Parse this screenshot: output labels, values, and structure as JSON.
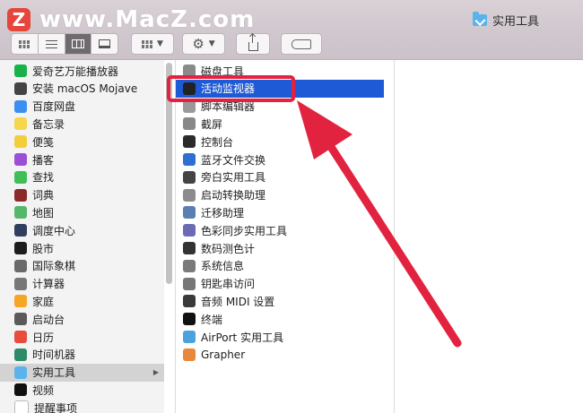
{
  "watermark": {
    "logo": "Z",
    "text": "www.MacZ.com"
  },
  "window": {
    "title": "实用工具",
    "title_icon": "folder-utilities-icon"
  },
  "toolbar": {
    "view_modes": [
      "icon-view",
      "list-view",
      "column-view",
      "gallery-view"
    ],
    "active_view": "column-view",
    "group_icon": "group-grid-icon",
    "action_icon": "gear-icon",
    "share_icon": "share-icon",
    "tag_icon": "tag-icon"
  },
  "sidebar_column": {
    "items": [
      {
        "label": "爱奇艺万能播放器",
        "icon": "iqiyi-player-icon",
        "color": "#19b24a"
      },
      {
        "label": "安装 macOS Mojave",
        "icon": "macos-mojave-installer-icon",
        "color": "#444444"
      },
      {
        "label": "百度网盘",
        "icon": "baidu-netdisk-icon",
        "color": "#3b8ff3"
      },
      {
        "label": "备忘录",
        "icon": "notes-icon",
        "color": "#f6d64b"
      },
      {
        "label": "便笺",
        "icon": "stickies-icon",
        "color": "#f2cf3a"
      },
      {
        "label": "播客",
        "icon": "podcasts-icon",
        "color": "#9b4fd7"
      },
      {
        "label": "查找",
        "icon": "find-my-icon",
        "color": "#3fbf57"
      },
      {
        "label": "词典",
        "icon": "dictionary-icon",
        "color": "#8b2a2a"
      },
      {
        "label": "地图",
        "icon": "maps-icon",
        "color": "#55b768"
      },
      {
        "label": "调度中心",
        "icon": "mission-control-icon",
        "color": "#2f3f5f"
      },
      {
        "label": "股市",
        "icon": "stocks-icon",
        "color": "#1c1c1c"
      },
      {
        "label": "国际象棋",
        "icon": "chess-icon",
        "color": "#6a6a6a"
      },
      {
        "label": "计算器",
        "icon": "calculator-icon",
        "color": "#777777"
      },
      {
        "label": "家庭",
        "icon": "home-icon",
        "color": "#f5a623"
      },
      {
        "label": "启动台",
        "icon": "launchpad-icon",
        "color": "#5a5a5a"
      },
      {
        "label": "日历",
        "icon": "calendar-icon",
        "color": "#e74c3c"
      },
      {
        "label": "时间机器",
        "icon": "time-machine-icon",
        "color": "#2f8a6a"
      },
      {
        "label": "实用工具",
        "icon": "utilities-folder-icon",
        "color": "#5bb3ec",
        "selected": true,
        "has_submenu": true
      },
      {
        "label": "视频",
        "icon": "tv-icon",
        "color": "#111111"
      },
      {
        "label": "提醒事项",
        "icon": "reminders-icon",
        "color": "#ffffff"
      }
    ]
  },
  "utilities_column": {
    "items": [
      {
        "label": "磁盘工具",
        "icon": "disk-utility-icon",
        "color": "#8a8a8a"
      },
      {
        "label": "活动监视器",
        "icon": "activity-monitor-icon",
        "color": "#222222",
        "selected": true
      },
      {
        "label": "脚本编辑器",
        "icon": "script-editor-icon",
        "color": "#9a9a9a"
      },
      {
        "label": "截屏",
        "icon": "screenshot-icon",
        "color": "#888888"
      },
      {
        "label": "控制台",
        "icon": "console-icon",
        "color": "#2b2b2b"
      },
      {
        "label": "蓝牙文件交换",
        "icon": "bluetooth-file-exchange-icon",
        "color": "#2f6fd0"
      },
      {
        "label": "旁白实用工具",
        "icon": "voiceover-utility-icon",
        "color": "#444444"
      },
      {
        "label": "启动转换助理",
        "icon": "boot-camp-assistant-icon",
        "color": "#8c8c8c"
      },
      {
        "label": "迁移助理",
        "icon": "migration-assistant-icon",
        "color": "#5b7fb3"
      },
      {
        "label": "色彩同步实用工具",
        "icon": "colorsync-utility-icon",
        "color": "#6b6bb5"
      },
      {
        "label": "数码测色计",
        "icon": "digital-color-meter-icon",
        "color": "#333333"
      },
      {
        "label": "系统信息",
        "icon": "system-information-icon",
        "color": "#7a7a7a"
      },
      {
        "label": "钥匙串访问",
        "icon": "keychain-access-icon",
        "color": "#777777"
      },
      {
        "label": "音频 MIDI 设置",
        "icon": "audio-midi-setup-icon",
        "color": "#3a3a3a"
      },
      {
        "label": "终端",
        "icon": "terminal-icon",
        "color": "#111111"
      },
      {
        "label": "AirPort 实用工具",
        "icon": "airport-utility-icon",
        "color": "#4aa3df"
      },
      {
        "label": "Grapher",
        "icon": "grapher-icon",
        "color": "#e8883a"
      }
    ]
  },
  "annotation": {
    "highlight_color": "#e2233f",
    "target": "活动监视器"
  }
}
